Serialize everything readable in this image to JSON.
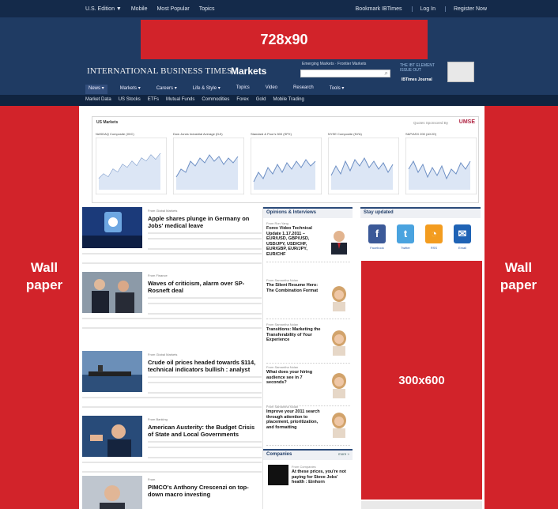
{
  "header": {
    "top_links_left": [
      "U.S. Edition ▼",
      "Mobile",
      "Most Popular",
      "Topics"
    ],
    "top_links_right": [
      "Bookmark IBTimes",
      "Log In",
      "Register Now"
    ],
    "leaderboard_label": "728x90",
    "logo": "INTERNATIONAL BUSINESS TIMES",
    "section": "Markets",
    "search_label": "Emerging Markets · Frontier Markets",
    "promo_text": "THE IBT ELEMENT ISSUE OUT",
    "promo_brand": "IBTimes Journal",
    "main_nav": [
      "News ▾",
      "Markets ▾",
      "Careers ▾",
      "Life & Style ▾",
      "Topics",
      "Video",
      "Research",
      "Tools ▾"
    ],
    "sub_nav": [
      "Market Data",
      "US Stocks",
      "ETFs",
      "Mutual Funds",
      "Commodities",
      "Forex",
      "Gold",
      "Mobile Trading"
    ]
  },
  "wallpaper": {
    "left": [
      "Wall",
      "paper"
    ],
    "right": [
      "Wall",
      "paper"
    ]
  },
  "indices": {
    "title": "US Markets",
    "sponsor_text": "Quotes Sponsored By",
    "sponsor_logo": "UMSE",
    "charts": [
      {
        "label": "NASDAQ Composite (IXIC)"
      },
      {
        "label": "Dow Jones Industrial Average (DJI)"
      },
      {
        "label": "Standard & Poor's 500 (SPX)"
      },
      {
        "label": "NYSE Composite (NYA)"
      },
      {
        "label": "S&P/ASX 200 (AXJO)"
      }
    ]
  },
  "news": [
    {
      "from": "From Global Markets",
      "headline": "Apple shares plunge in Germany on Jobs' medical leave"
    },
    {
      "from": "From Finance",
      "headline": "Waves of criticism, alarm over SP-Rosneft deal"
    },
    {
      "from": "From Global Markets",
      "headline": "Crude oil prices headed towards $114, technical indicators bullish : analyst"
    },
    {
      "from": "From Banking",
      "headline": "American Austerity: the Budget Crisis of State and Local Governments"
    },
    {
      "from": "From",
      "headline": "PIMCO's Anthony Crescenzi on top-down macro investing"
    }
  ],
  "opinions": {
    "title": "Opinions & Interviews",
    "items": [
      {
        "from": "From Ron Yang",
        "title": "Forex Video Technical Update 1.17.2011 – EUR/USD, GBP/USD, USD/JPY, USD/CHF, EUR/GBP, EUR/JPY, EUR/CHF"
      },
      {
        "from": "From Samantha Nolan",
        "title": "The Silent Resume Hero: The Combination Format"
      },
      {
        "from": "From Samantha Nolan",
        "title": "Transitions: Marketing the Transferability of Your Experience"
      },
      {
        "from": "From Samantha Nolan",
        "title": "What does your hiring audience see in 7 seconds?"
      },
      {
        "from": "From Samantha Nolan",
        "title": "Improve your 2011 search through attention to placement, prioritization, and formatting"
      }
    ]
  },
  "companies": {
    "title": "Companies",
    "more": "more »",
    "item_from": "From Companies",
    "item_title": "At these prices, you're not paying for Steve Jobs' health : Einhorn"
  },
  "stay_updated": {
    "title": "Stay updated",
    "items": [
      {
        "label": "Facebook",
        "glyph": "f",
        "color": "#3b5998"
      },
      {
        "label": "Twitter",
        "glyph": "t",
        "color": "#4aa3df"
      },
      {
        "label": "RSS",
        "glyph": "◔",
        "color": "#f39c1f"
      },
      {
        "label": "Email",
        "glyph": "✉",
        "color": "#1f63b5"
      }
    ]
  },
  "ads": {
    "rectangle_label": "300x600"
  }
}
